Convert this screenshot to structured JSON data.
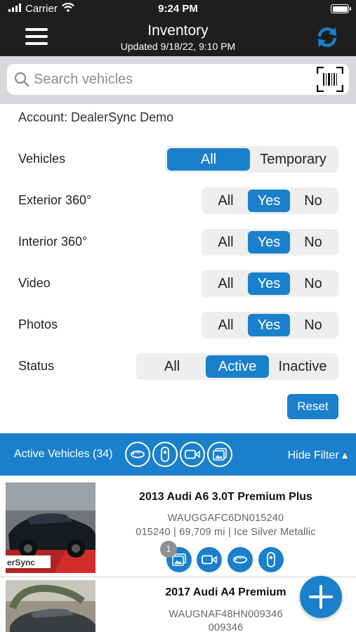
{
  "status_bar": {
    "carrier": "Carrier",
    "time": "9:24 PM"
  },
  "header": {
    "title": "Inventory",
    "subtitle": "Updated 9/18/22, 9:10 PM"
  },
  "search": {
    "placeholder": "Search vehicles",
    "value": ""
  },
  "account": "Account: DealerSync Demo",
  "filters": {
    "vehicles": {
      "label": "Vehicles",
      "options": [
        "All",
        "Temporary"
      ],
      "selected": "All"
    },
    "exterior": {
      "label": "Exterior 360°",
      "options": [
        "All",
        "Yes",
        "No"
      ],
      "selected": "Yes"
    },
    "interior": {
      "label": "Interior 360°",
      "options": [
        "All",
        "Yes",
        "No"
      ],
      "selected": "Yes"
    },
    "video": {
      "label": "Video",
      "options": [
        "All",
        "Yes",
        "No"
      ],
      "selected": "Yes"
    },
    "photos": {
      "label": "Photos",
      "options": [
        "All",
        "Yes",
        "No"
      ],
      "selected": "Yes"
    },
    "status": {
      "label": "Status",
      "options": [
        "All",
        "Active",
        "Inactive"
      ],
      "selected": "Active"
    }
  },
  "reset_label": "Reset",
  "filter_bar": {
    "count_label": "Active Vehicles (34)",
    "hide_label": "Hide Filter ▴",
    "icons": [
      "exterior-360-icon",
      "interior-360-icon",
      "video-icon",
      "photos-icon"
    ]
  },
  "vehicles": [
    {
      "title": "2013 Audi A6 3.0T Premium Plus",
      "vin": "WAUGGAFC6DN015240",
      "details": "015240 | 69,709 mi | Ice Silver Metallic",
      "photo_badge": "1",
      "thumb_text": "erSync",
      "icons": [
        "photos-icon",
        "video-icon",
        "exterior-360-icon",
        "interior-360-icon"
      ]
    },
    {
      "title": "2017 Audi A4 Premium",
      "vin": "WAUGNAF48HN009346",
      "details": "009346"
    }
  ],
  "colors": {
    "accent": "#1a80cc",
    "header_bg": "#1e1e1e",
    "search_bg": "#d7d7dc"
  }
}
